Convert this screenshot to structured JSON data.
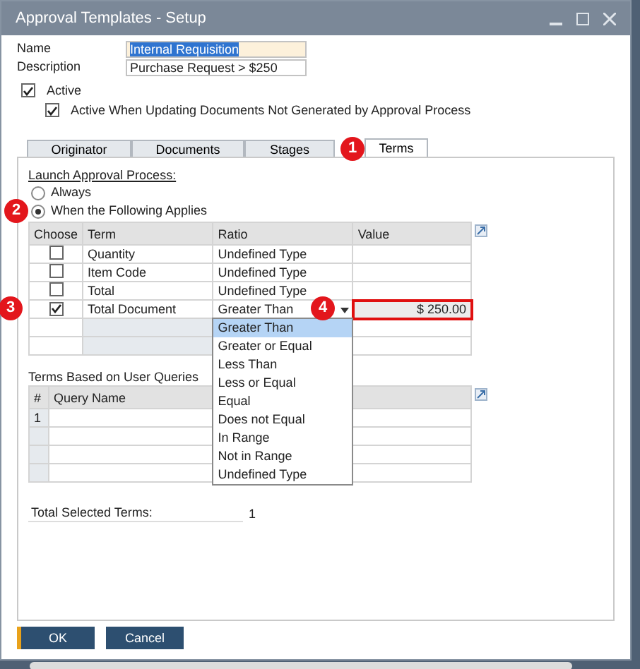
{
  "window": {
    "title": "Approval Templates - Setup"
  },
  "fields": [
    {
      "label": "Name",
      "value": "Internal Requisition",
      "selected": true
    },
    {
      "label": "Description",
      "value": "Purchase Request > $250",
      "selected": false
    }
  ],
  "checkboxes": [
    {
      "label": "Active",
      "checked": true,
      "children": [
        {
          "label": "Active When Updating Documents Not Generated by Approval Process",
          "checked": true
        }
      ]
    }
  ],
  "tabs": [
    {
      "label": "Originator",
      "selected": false
    },
    {
      "label": "Documents",
      "selected": false
    },
    {
      "label": "Stages",
      "selected": false
    },
    {
      "label": "Terms",
      "selected": true,
      "callout": "1"
    }
  ],
  "launch": {
    "heading": "Launch Approval Process:",
    "options": [
      {
        "label": "Always",
        "selected": false
      },
      {
        "label": "When the Following Applies",
        "selected": true,
        "callout": "2"
      }
    ]
  },
  "terms_table": {
    "columns": [
      "Choose",
      "Term",
      "Ratio",
      "Value"
    ],
    "rows": [
      {
        "checked": false,
        "term": "Quantity",
        "ratio": "Undefined Type"
      },
      {
        "checked": false,
        "term": "Item Code",
        "ratio": "Undefined Type"
      },
      {
        "checked": false,
        "term": "Total",
        "ratio": "Undefined Type"
      },
      {
        "checked": true,
        "term": "Total Document",
        "ratio": "Greater Than",
        "value": "$ 250.00",
        "callout": "3",
        "value_callout": "4",
        "open": true
      }
    ]
  },
  "ratio_dropdown": {
    "items": [
      {
        "label": "Greater Than",
        "selected": true
      },
      {
        "label": "Greater or Equal",
        "selected": false
      },
      {
        "label": "Less Than",
        "selected": false
      },
      {
        "label": "Less or Equal",
        "selected": false
      },
      {
        "label": "Equal",
        "selected": false
      },
      {
        "label": "Does not Equal",
        "selected": false
      },
      {
        "label": "In Range",
        "selected": false
      },
      {
        "label": "Not in Range",
        "selected": false
      },
      {
        "label": "Undefined Type",
        "selected": false
      }
    ]
  },
  "queries": {
    "title": "Terms Based on User Queries",
    "columns": [
      "#",
      "Query Name"
    ],
    "rows": [
      {
        "number": "1"
      }
    ]
  },
  "total": {
    "label": "Total Selected Terms:",
    "value": "1"
  },
  "buttons": [
    {
      "label": "OK",
      "default": true
    },
    {
      "label": "Cancel",
      "default": false
    }
  ]
}
